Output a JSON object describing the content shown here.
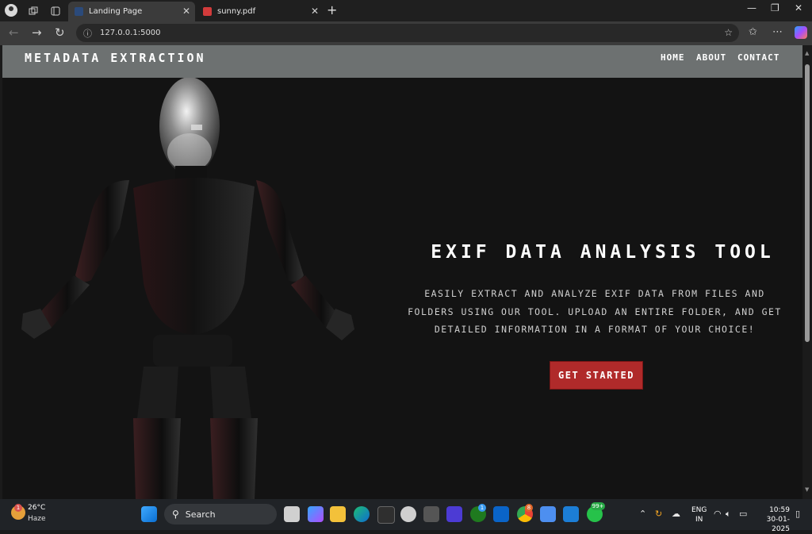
{
  "browser": {
    "tabs": [
      {
        "title": "Landing Page",
        "active": true
      },
      {
        "title": "sunny.pdf",
        "active": false
      }
    ],
    "address": "127.0.0.1:5000"
  },
  "site": {
    "brand": "METADATA EXTRACTION",
    "nav": [
      "HOME",
      "ABOUT",
      "CONTACT"
    ],
    "hero": {
      "title": "EXIF DATA ANALYSIS TOOL",
      "description": "Easily extract and analyze EXIF data from files and folders using our tool. Upload an entire folder, and get detailed information in a format of your choice!",
      "cta": "GET STARTED"
    }
  },
  "taskbar": {
    "weather": {
      "temp": "26°C",
      "condition": "Haze",
      "badge": "1"
    },
    "search_label": "Search",
    "badges": {
      "xbox": "1",
      "chrome": "8",
      "whatsapp": "99+"
    },
    "language": {
      "line1": "ENG",
      "line2": "IN"
    },
    "time": "10:59",
    "date": "30-01-2025"
  },
  "colors": {
    "nav_bg": "#6d7171",
    "cta_bg": "#b02a2a",
    "page_bg": "#131313"
  }
}
